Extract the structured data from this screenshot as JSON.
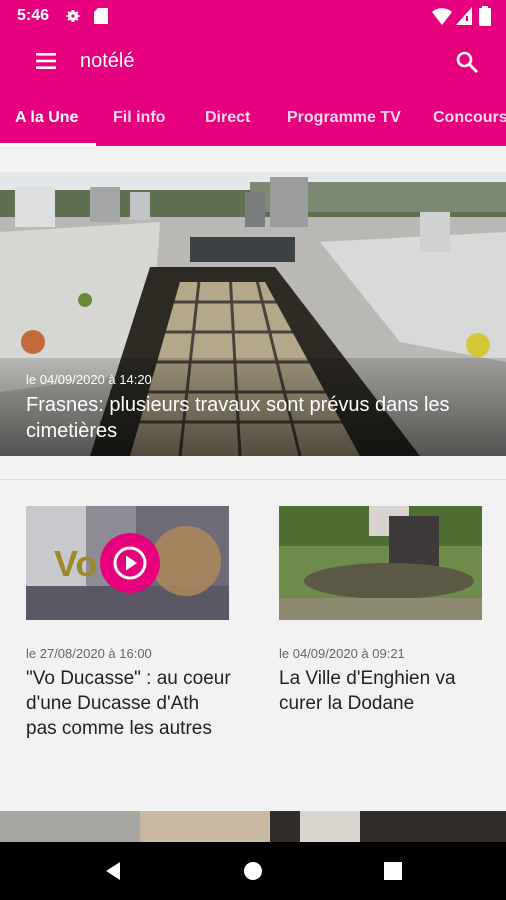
{
  "status_bar": {
    "time": "5:46",
    "icons": [
      "gear-icon",
      "sd-card-icon",
      "wifi-icon",
      "signal-icon",
      "battery-icon"
    ]
  },
  "app_bar": {
    "title": "notélé",
    "menu_icon": "hamburger-menu-icon",
    "search_icon": "search-icon"
  },
  "tabs": [
    {
      "label": "A la Une",
      "active": true
    },
    {
      "label": "Fil info",
      "active": false
    },
    {
      "label": "Direct",
      "active": false
    },
    {
      "label": "Programme TV",
      "active": false
    },
    {
      "label": "Concours",
      "active": false
    }
  ],
  "hero": {
    "date": "le 04/09/2020 à 14:20",
    "headline": "Frasnes: plusieurs travaux sont prévus dans les cimetières"
  },
  "cards": [
    {
      "date": "le 27/08/2020 à 16:00",
      "title": "\"Vo Ducasse\" : au coeur d'une Ducasse d'Ath pas comme les autres",
      "has_video": true,
      "thumb_text": "Vo"
    },
    {
      "date": "le 04/09/2020 à 09:21",
      "title": "La Ville d'Enghien va curer la Dodane",
      "has_video": false
    }
  ],
  "colors": {
    "brand": "#e6007e",
    "background": "#f2f2f2",
    "text": "#222222",
    "meta": "#666666"
  },
  "nav_bar": {
    "icons": [
      "back-icon",
      "home-icon",
      "recents-icon"
    ]
  }
}
